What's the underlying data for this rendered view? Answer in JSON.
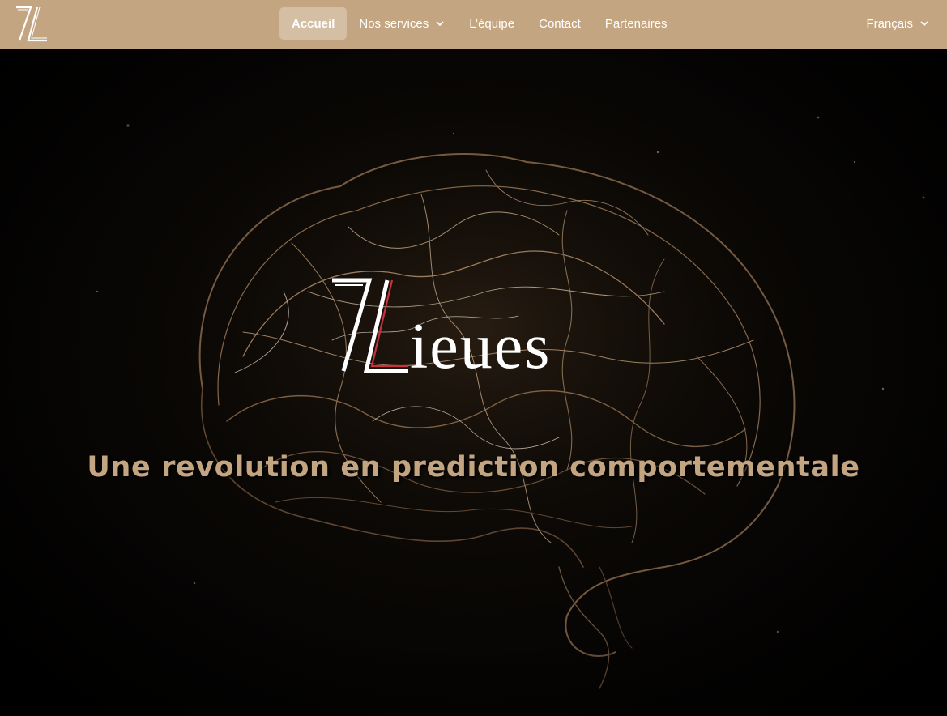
{
  "header": {
    "logo_text": "7L",
    "nav": [
      {
        "label": "Accueil",
        "active": true
      },
      {
        "label": "Nos services",
        "dropdown": true
      },
      {
        "label": "L’équipe"
      },
      {
        "label": "Contact"
      },
      {
        "label": "Partenaires"
      }
    ],
    "language": {
      "label": "Français",
      "dropdown": true
    }
  },
  "hero": {
    "brand": "7Lieues",
    "tagline": "Une revolution en prediction comportementale"
  },
  "colors": {
    "header_bg": "#c4a582",
    "accent": "#c4a582",
    "logo_red": "#c8323c"
  }
}
